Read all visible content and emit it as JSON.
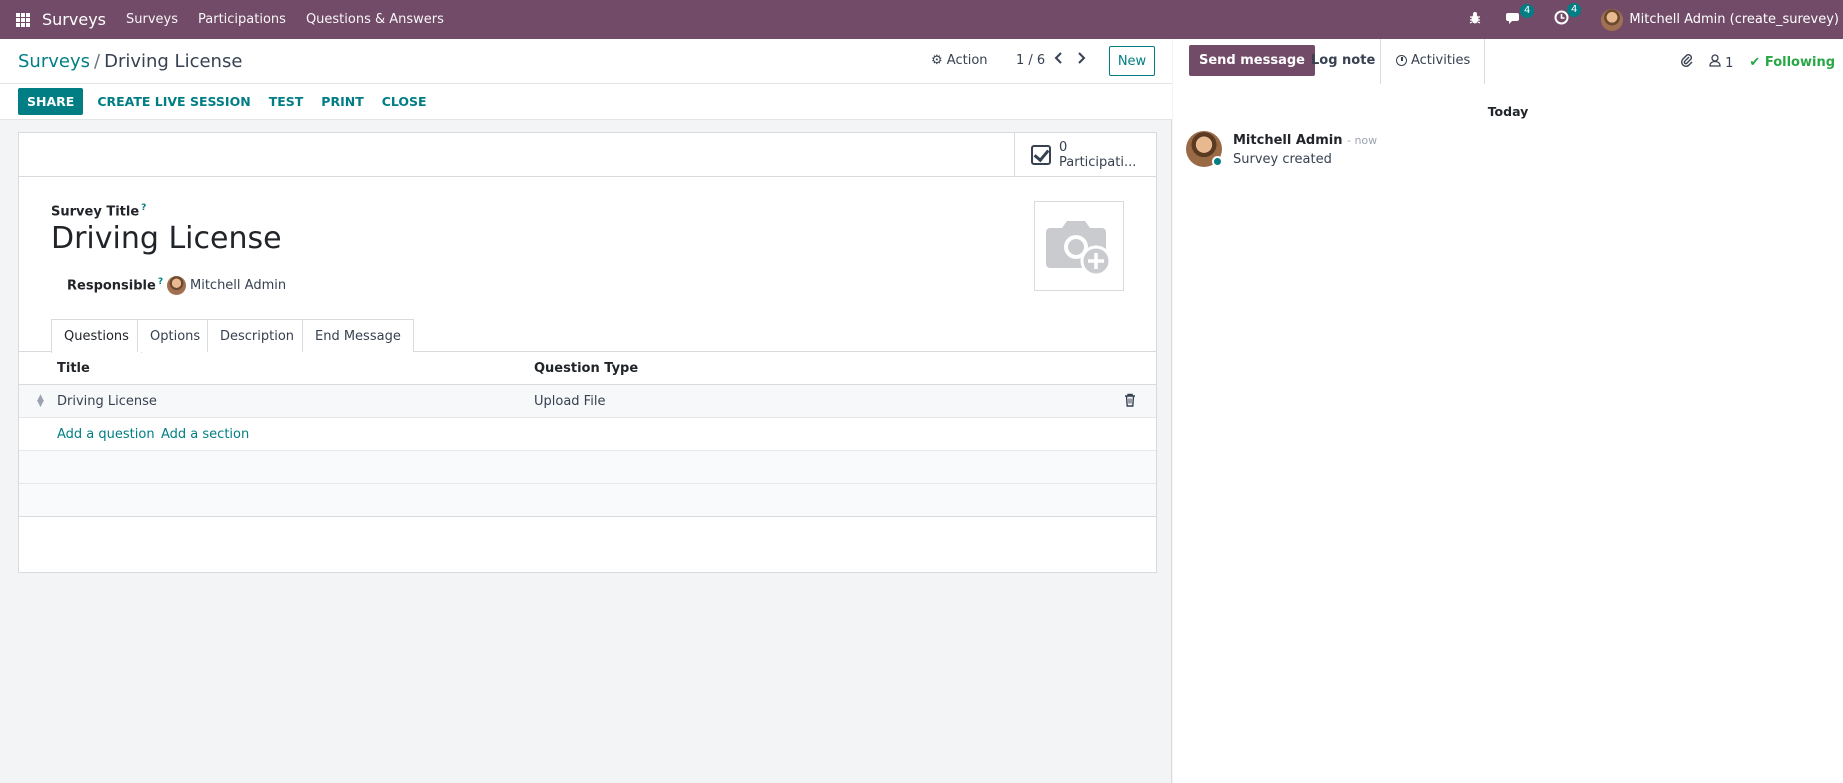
{
  "navbar": {
    "brand": "Surveys",
    "menu": [
      "Surveys",
      "Participations",
      "Questions & Answers"
    ],
    "messages_badge": "4",
    "activities_badge": "4",
    "user_name": "Mitchell Admin (create_surevey)"
  },
  "control_panel": {
    "breadcrumb_parent": "Surveys",
    "breadcrumb_sep": "/",
    "breadcrumb_current": "Driving License",
    "action_label": "Action",
    "pager": "1 / 6",
    "new_label": "New"
  },
  "statusbar": {
    "share": "SHARE",
    "live_session": "CREATE LIVE SESSION",
    "test": "TEST",
    "print": "PRINT",
    "close": "CLOSE"
  },
  "form": {
    "participations_count": "0",
    "participations_label": "Participati...",
    "title_label": "Survey Title",
    "title_value": "Driving License",
    "responsible_label": "Responsible",
    "responsible_value": "Mitchell Admin",
    "help_mark": "?",
    "tabs": [
      "Questions",
      "Options",
      "Description",
      "End Message"
    ],
    "columns": [
      "Title",
      "Question Type"
    ],
    "rows": [
      {
        "title": "Driving License",
        "type": "Upload File"
      }
    ],
    "add_question": "Add a question",
    "add_section": "Add a section"
  },
  "chatter": {
    "send_message": "Send message",
    "log_note": "Log note",
    "activities": "Activities",
    "followers_count": "1",
    "following": "Following",
    "today": "Today",
    "message_author": "Mitchell Admin",
    "message_time": "- now",
    "message_body": "Survey created"
  },
  "colors": {
    "brand": "#714b67",
    "accent": "#017e84",
    "following": "#28a745"
  }
}
